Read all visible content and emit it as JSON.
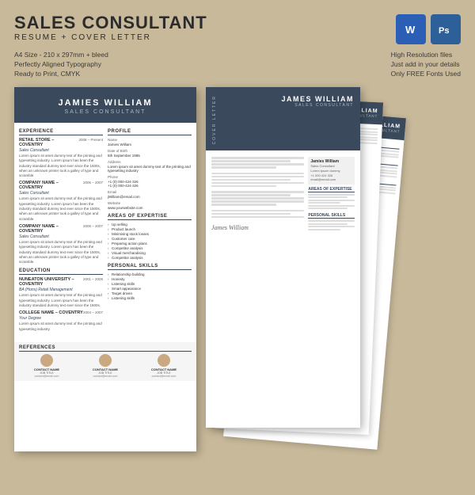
{
  "header": {
    "title": "SALES CONSULTANT",
    "subtitle": "RESUME + COVER LETTER",
    "word_icon": "W",
    "ps_icon": "Ps"
  },
  "info": {
    "left": [
      "A4 Size - 210 x 297mm + bleed",
      "Perfectly Aligned Typography",
      "Ready to Print, CMYK"
    ],
    "right": [
      "High Resolution files",
      "Just add in your details",
      "Only FREE Fonts Used"
    ]
  },
  "resume": {
    "name": "JAMIES WILLIAM",
    "role": "SALES CONSULTANT",
    "experience": {
      "label": "EXPERIENCE",
      "jobs": [
        {
          "company": "RETAIL STORE – COVENTRY",
          "title": "Sales Consultant",
          "dates": "2008 – Present",
          "text": "Lorem ipsum sit amet dummy text of the printing and typesetting industry. Lorem ipsum has been the industry's standard dummy text ever since the 1500s, when an unknown printer took a galley of type and scramble."
        },
        {
          "company": "COMPANY NAME – COVENTRY",
          "title": "Sales Consultant",
          "dates": "2006 – 2007",
          "text": "Lorem ipsum sit amet dummy text of the printing and typesetting industry. Lorem ipsum has been the industry's standard dummy text ever since the 1500s, when an unknown printer took a galley of type and scramble."
        },
        {
          "company": "COMPANY NAME – COVENTRY",
          "title": "Sales Consultant",
          "dates": "2006 – 2007",
          "text": "Lorem ipsum sit amet dummy text of the printing and typesetting industry. Lorem ipsum has been the industry's standard dummy text ever since the 1500s, when an unknown printer took a galley of type and scramble."
        }
      ]
    },
    "education": {
      "label": "EDUCATION",
      "items": [
        {
          "school": "NUNEATON UNIVERSITY – COVENTRY",
          "degree": "BA (Hons) Retail Management",
          "dates": "2001 – 2005",
          "text": "Lorem ipsum sit amet dummy text of the printing and typesetting industry. Lorem ipsum has been the industry's standard dummy text ever since the 1500s."
        },
        {
          "school": "COLLEGE NAME – COVENTRY",
          "degree": "Your Degree",
          "dates": "2004 – 2007",
          "text": "Lorem ipsum sit amet dummy text of the printing and typesetting industry."
        }
      ]
    },
    "references": {
      "label": "REFERENCES",
      "contacts": [
        {
          "name": "CONTACT NAME",
          "title": "JOB TITLE",
          "detail": "contact@email.com"
        },
        {
          "name": "CONTACT NAME",
          "title": "JOB TITLE",
          "detail": "contact@email.com"
        },
        {
          "name": "CONTACT NAME",
          "title": "JOB TITLE",
          "detail": "contact@email.com"
        }
      ]
    },
    "profile": {
      "label": "PROFILE",
      "name_label": "Name",
      "name_val": "Jamies William",
      "dob_label": "Date of Birth",
      "dob_val": "5th September 1985",
      "address_label": "Address",
      "address_val": "Lorem ipsum sit amet dummy text of the printing and typesetting industry",
      "phone_label": "Phone",
      "phone_val": "+1 (0) 000-424-326\n+1 (0) 000-424-326",
      "email_label": "Email",
      "email_val": "jWilliam@email.com",
      "website_label": "Website",
      "website_val": "www.yourwebsite.com"
    },
    "expertise": {
      "label": "AREAS OF EXPERTISE",
      "items": [
        "Up selling",
        "Product launch",
        "Minimising stock losses",
        "Customer care",
        "Preparing action plans",
        "Competitor analysis",
        "Visual merchandising",
        "Competitor analysis"
      ]
    },
    "skills": {
      "label": "PERSONAL SKILLS",
      "items": [
        "Relationship building",
        "Honesty",
        "Listening skills",
        "Smart appearance",
        "Target driven",
        "Listening skills"
      ]
    }
  },
  "cover": {
    "label": "COVER LETTER",
    "name": "JAMES WILLIAM",
    "role": "SALES CONSULTANT",
    "signature": "James William"
  },
  "colors": {
    "bg": "#c8b99a",
    "dark_blue": "#3a4a5c",
    "word_blue": "#2b5eb5",
    "ps_blue": "#2d6099",
    "accent": "#c9a882"
  }
}
